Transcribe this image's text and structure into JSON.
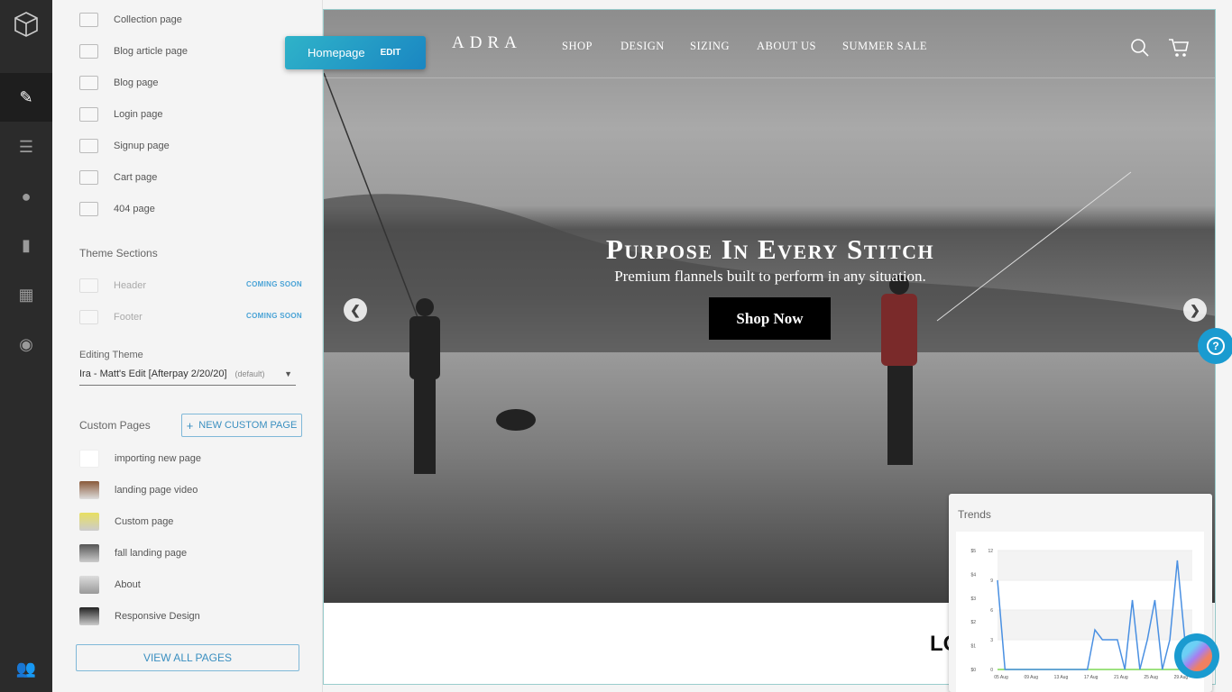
{
  "rail": {
    "icons": [
      "cube-logo-icon",
      "magic-wand-icon",
      "list-icon",
      "dots-icon",
      "bookmark-icon",
      "widgets-icon",
      "account-icon",
      "users-icon"
    ]
  },
  "pages": [
    {
      "label": "Collection page"
    },
    {
      "label": "Blog article page"
    },
    {
      "label": "Blog page"
    },
    {
      "label": "Login page"
    },
    {
      "label": "Signup page"
    },
    {
      "label": "Cart page"
    },
    {
      "label": "404 page"
    }
  ],
  "theme_sections": {
    "title": "Theme Sections",
    "items": [
      {
        "label": "Header",
        "badge": "COMING SOON"
      },
      {
        "label": "Footer",
        "badge": "COMING SOON"
      }
    ]
  },
  "editing_theme": {
    "label": "Editing Theme",
    "value": "Ira - Matt's Edit [Afterpay 2/20/20]",
    "tag": "(default)"
  },
  "custom_pages": {
    "title": "Custom Pages",
    "new_button": "NEW CUSTOM PAGE",
    "items": [
      {
        "label": "importing new page"
      },
      {
        "label": "landing page video"
      },
      {
        "label": "Custom page"
      },
      {
        "label": "fall landing page"
      },
      {
        "label": "About"
      },
      {
        "label": "Responsive Design"
      }
    ],
    "view_all": "VIEW ALL PAGES"
  },
  "page_chip": {
    "name": "Homepage",
    "edit": "EDIT"
  },
  "site": {
    "logo": "ADRA",
    "nav": [
      "SHOP",
      "DESIGN",
      "SIZING",
      "ABOUT US",
      "SUMMER SALE"
    ],
    "headline": "Purpose In Every Stitch",
    "subheadline": "Premium flannels built to perform in any situation.",
    "cta": "Shop Now",
    "below_text": "LO"
  },
  "colors": {
    "accent": "#1a9bd0",
    "chart_line": "#4a90e2",
    "chart_zero": "#7ed957"
  },
  "chart_data": {
    "type": "line",
    "title": "Trends",
    "x": [
      "05 Aug",
      "06 Aug",
      "07 Aug",
      "08 Aug",
      "09 Aug",
      "10 Aug",
      "11 Aug",
      "12 Aug",
      "13 Aug",
      "14 Aug",
      "15 Aug",
      "16 Aug",
      "17 Aug",
      "18 Aug",
      "19 Aug",
      "20 Aug",
      "21 Aug",
      "22 Aug",
      "23 Aug",
      "24 Aug",
      "25 Aug",
      "26 Aug",
      "27 Aug",
      "28 Aug",
      "29 Aug",
      "30 Aug",
      "31 Aug"
    ],
    "xticks": [
      "05 Aug",
      "09 Aug",
      "13 Aug",
      "17 Aug",
      "21 Aug",
      "25 Aug",
      "29 Aug"
    ],
    "series": [
      {
        "values": [
          9,
          0,
          0,
          0,
          0,
          0,
          0,
          0,
          0,
          0,
          0,
          0,
          0,
          4,
          3,
          3,
          3,
          0,
          7,
          0,
          3,
          7,
          0,
          3,
          11,
          3,
          0
        ],
        "axis": "right"
      },
      {
        "values": [
          0,
          0,
          0,
          0,
          0,
          0,
          0,
          0,
          0,
          0,
          0,
          0,
          0,
          0,
          0,
          0,
          0,
          0,
          0,
          0,
          0,
          0,
          0,
          0,
          0,
          0,
          0
        ],
        "axis": "left"
      }
    ],
    "y_left": {
      "ticks": [
        "$0",
        "$1",
        "$2",
        "$3",
        "$4",
        "$5"
      ],
      "range": [
        0,
        5
      ]
    },
    "y_right": {
      "ticks": [
        "0",
        "3",
        "6",
        "9",
        "12"
      ],
      "range": [
        0,
        12
      ]
    },
    "grid": true
  }
}
